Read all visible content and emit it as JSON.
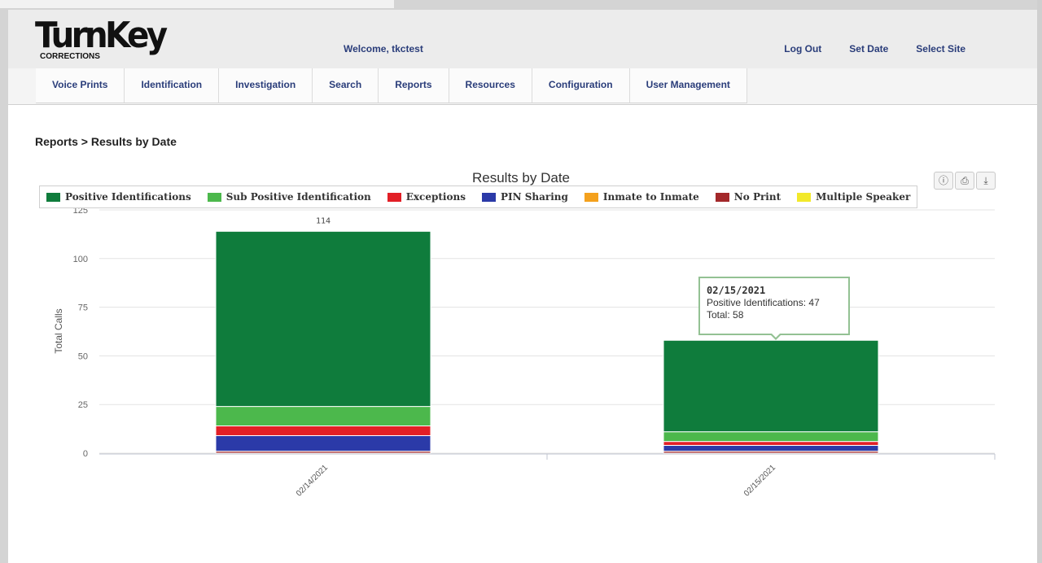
{
  "header": {
    "logo_text": "TurnKey",
    "logo_sub": "CORRECTIONS",
    "welcome": "Welcome, tkctest",
    "links": [
      "Log Out",
      "Set Date",
      "Select Site"
    ]
  },
  "nav": [
    "Voice Prints",
    "Identification",
    "Investigation",
    "Search",
    "Reports",
    "Resources",
    "Configuration",
    "User Management"
  ],
  "breadcrumb": "Reports > Results by Date",
  "toolbar_icons": [
    "info-icon",
    "print-icon",
    "download-icon"
  ],
  "tooltip": {
    "date": "02/15/2021",
    "line1": "Positive Identifications: 47",
    "line2": "Total: 58"
  },
  "chart_data": {
    "type": "bar",
    "stacked": true,
    "title": "Results by Date",
    "ylabel": "Total Calls",
    "xlabel": "",
    "ylim": [
      0,
      125
    ],
    "yticks": [
      0,
      25,
      50,
      75,
      100,
      125
    ],
    "categories": [
      "02/14/2021",
      "02/15/2021"
    ],
    "legend_position": "top",
    "series": [
      {
        "name": "Positive Identifications",
        "color": "#0f7c3c",
        "values": [
          90,
          47
        ]
      },
      {
        "name": "Sub Positive Identification",
        "color": "#4cb84c",
        "values": [
          10,
          5
        ]
      },
      {
        "name": "Exceptions",
        "color": "#e21f26",
        "values": [
          5,
          2
        ]
      },
      {
        "name": "PIN Sharing",
        "color": "#2b3aa8",
        "values": [
          8,
          3
        ]
      },
      {
        "name": "Inmate to Inmate",
        "color": "#f4a11d",
        "values": [
          0,
          0
        ]
      },
      {
        "name": "No Print",
        "color": "#a3282a",
        "values": [
          1,
          1
        ]
      },
      {
        "name": "Multiple Speaker",
        "color": "#f2e92a",
        "values": [
          0,
          0
        ]
      }
    ],
    "totals": [
      114,
      58
    ],
    "data_labels": [
      "114",
      ""
    ]
  }
}
